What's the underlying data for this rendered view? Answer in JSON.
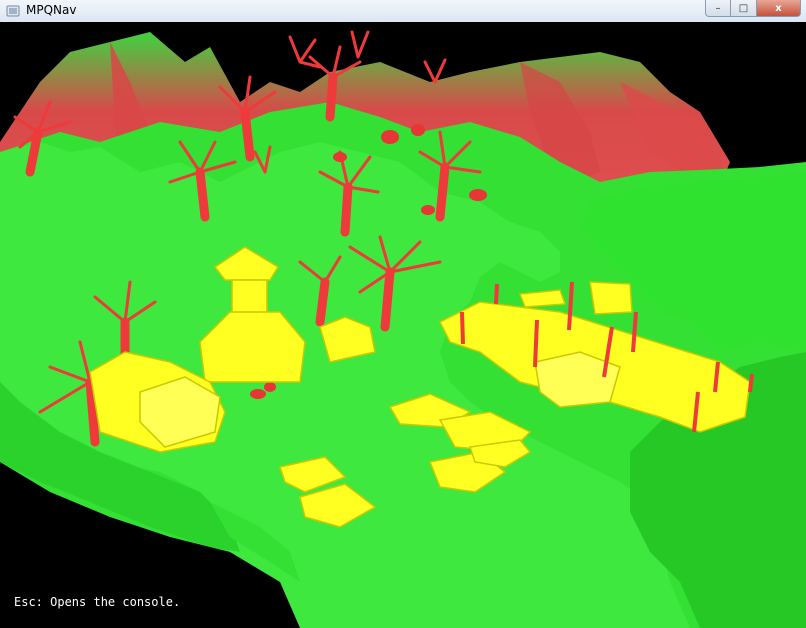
{
  "window": {
    "title": "MPQNav",
    "buttons": {
      "minimize": "–",
      "maximize": "□",
      "close": "x"
    }
  },
  "viewport": {
    "console_hint": "Esc: Opens the console."
  },
  "colors": {
    "terrain": "#2ee52e",
    "cliff": "#e14b4b",
    "trees": "#ee3a3a",
    "buildings": "#ffff22",
    "background": "#000000"
  }
}
